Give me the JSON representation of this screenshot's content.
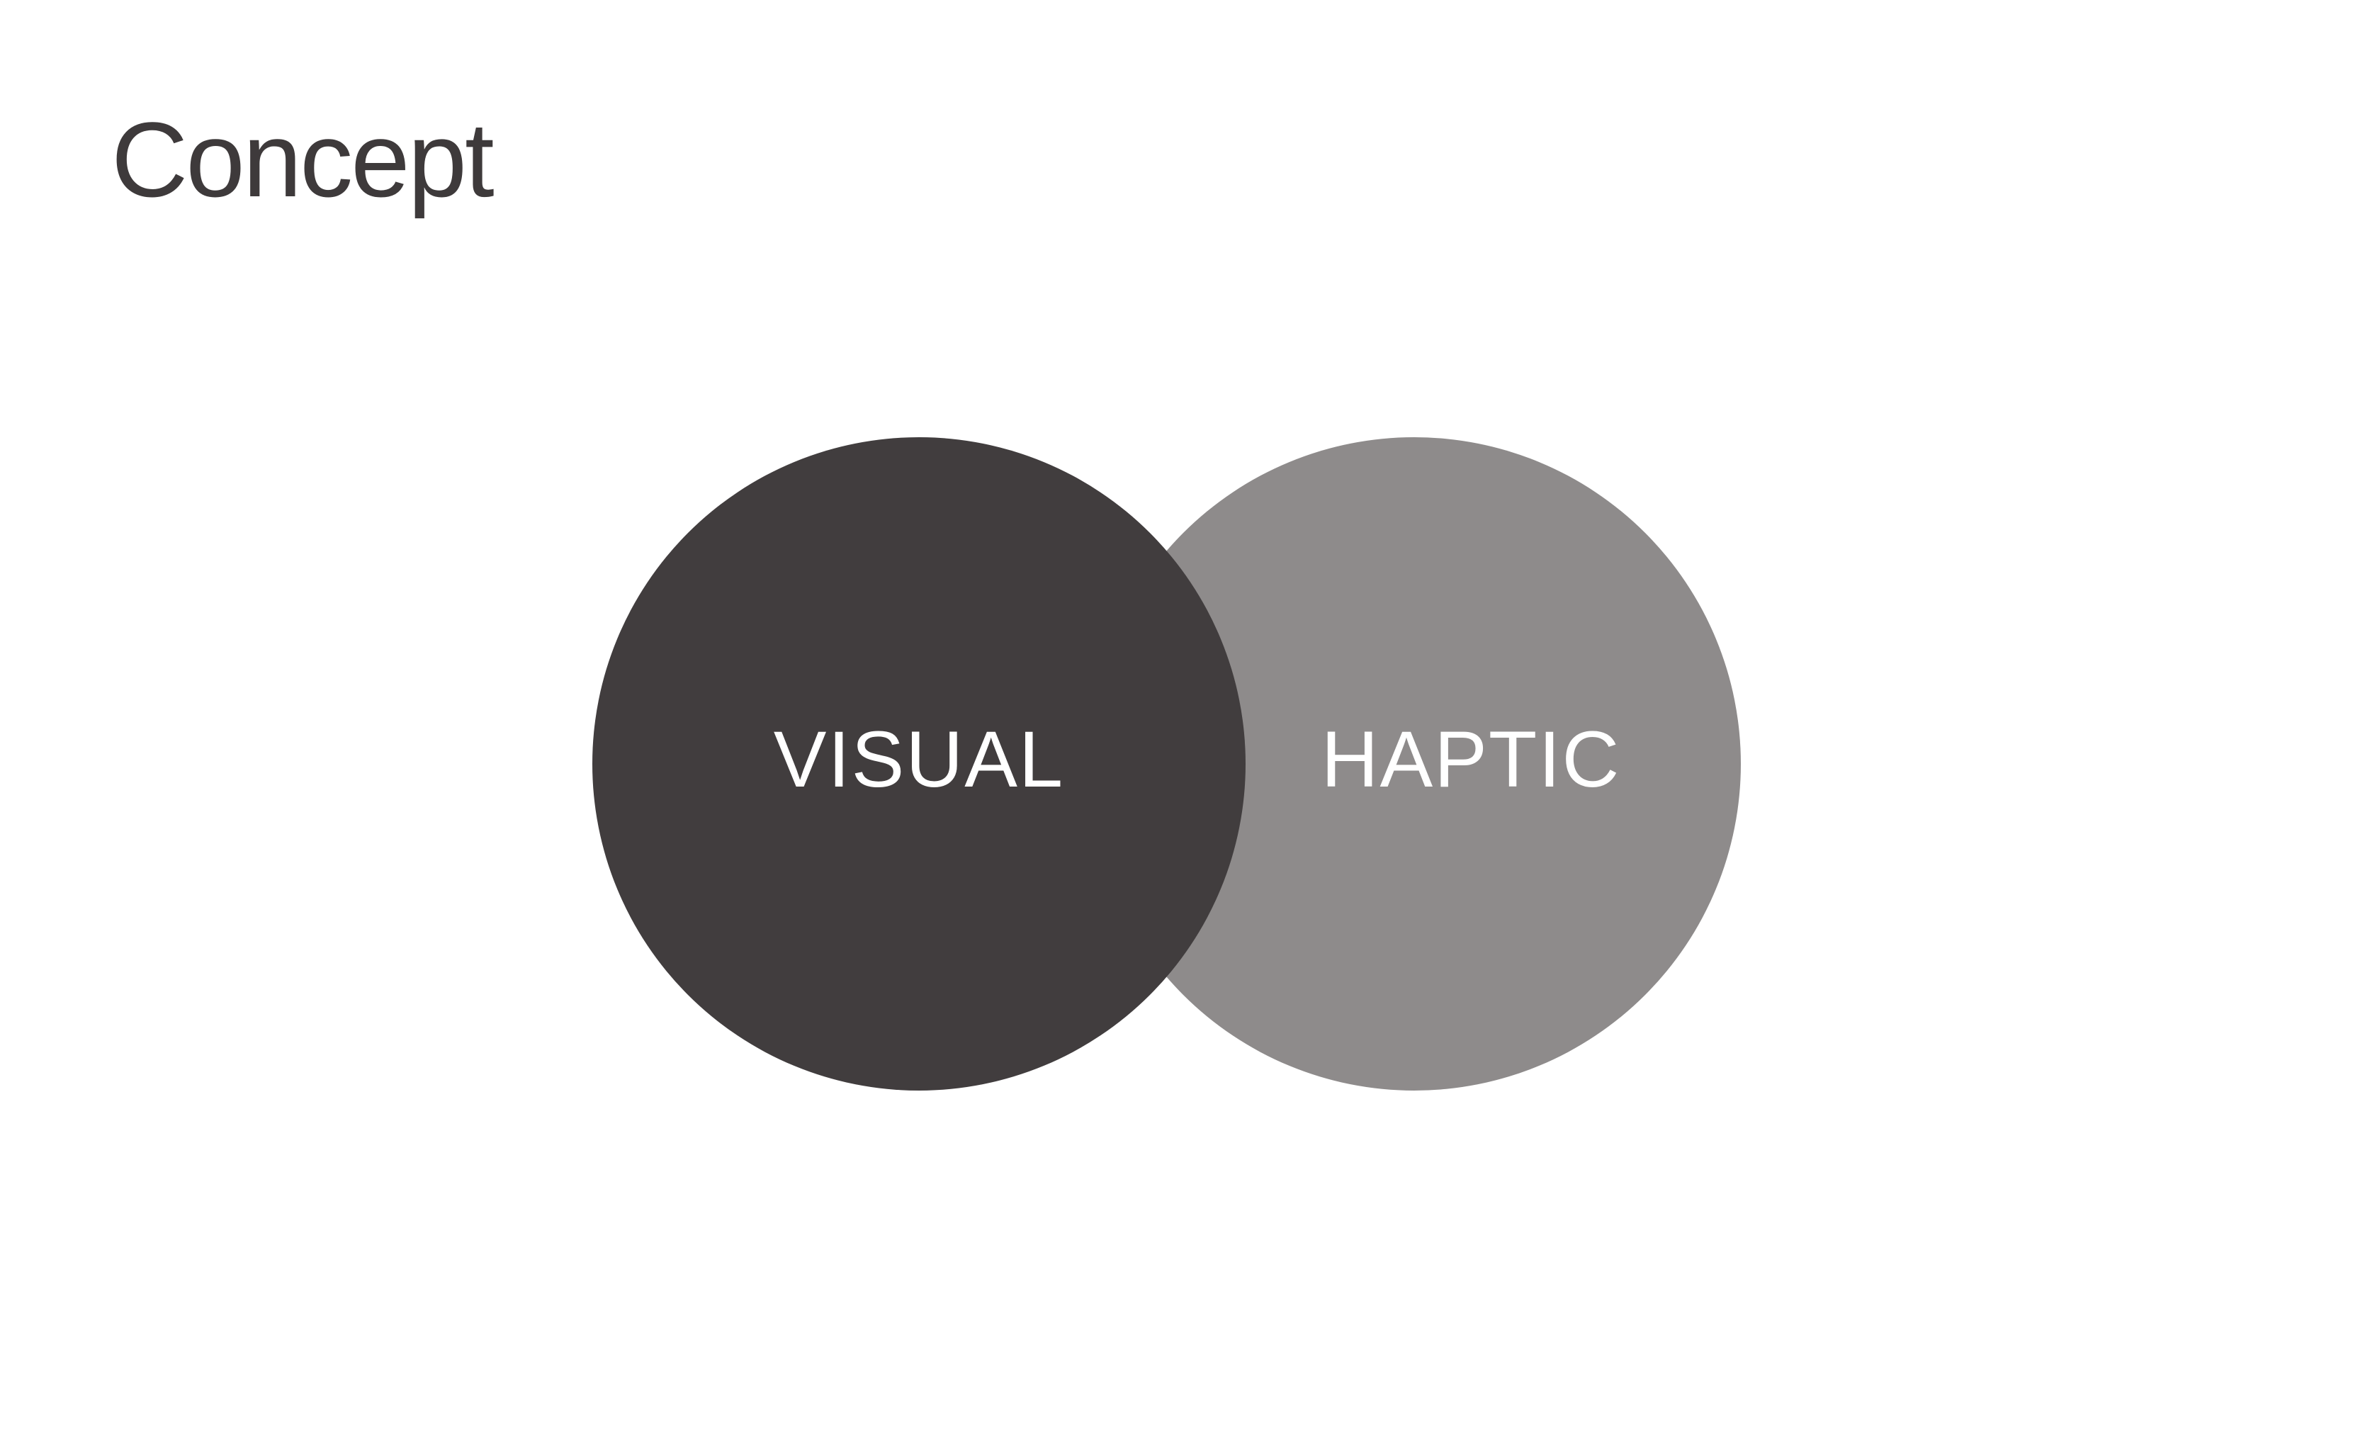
{
  "page": {
    "title": "Concept"
  },
  "diagram": {
    "type": "venn",
    "sets": [
      {
        "label": "VISUAL",
        "color": "#413d3e"
      },
      {
        "label": "HAPTIC",
        "color": "#8e8b8b"
      }
    ],
    "label_color": "#ffffff"
  }
}
